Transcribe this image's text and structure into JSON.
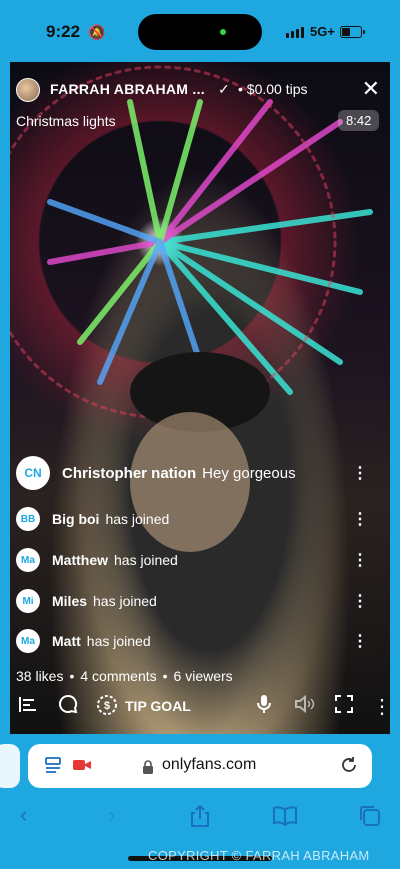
{
  "status": {
    "time": "9:22",
    "network": "5G+"
  },
  "stream": {
    "creator_name": "FARRAH ABRAHAM ...",
    "separator": "•",
    "tips": "$0.00 tips",
    "subtitle": "Christmas lights",
    "timer": "8:42"
  },
  "comments": [
    {
      "initials": "CN",
      "name": "Christopher nation",
      "message": "Hey gorgeous"
    },
    {
      "initials": "BB",
      "name": "Big boi",
      "message": "has joined"
    },
    {
      "initials": "Ma",
      "name": "Matthew",
      "message": "has joined"
    },
    {
      "initials": "Mi",
      "name": "Miles",
      "message": "has joined"
    },
    {
      "initials": "Ma",
      "name": "Matt",
      "message": "has joined"
    }
  ],
  "stats": {
    "likes": "38 likes",
    "comments": "4 comments",
    "viewers": "6 viewers"
  },
  "controls": {
    "tip_goal_label": "TIP GOAL"
  },
  "browser": {
    "url": "onlyfans.com"
  },
  "watermark": "COPYRIGHT © FARRAH ABRAHAM",
  "colors": {
    "accent": "#1fa8e0",
    "badge_text": "#1fa8e0",
    "safari_blue": "#1a6fc0"
  },
  "icons": [
    "bell-slash-icon",
    "verified-icon",
    "close-icon",
    "kebab-icon",
    "poll-icon",
    "chat-bubble-icon",
    "tip-dollar-icon",
    "microphone-icon",
    "speaker-muted-icon",
    "fullscreen-icon",
    "more-icon",
    "reader-icon",
    "camera-icon",
    "lock-icon",
    "reload-icon",
    "back-icon",
    "forward-icon",
    "share-icon",
    "bookmarks-icon",
    "tabs-icon"
  ]
}
